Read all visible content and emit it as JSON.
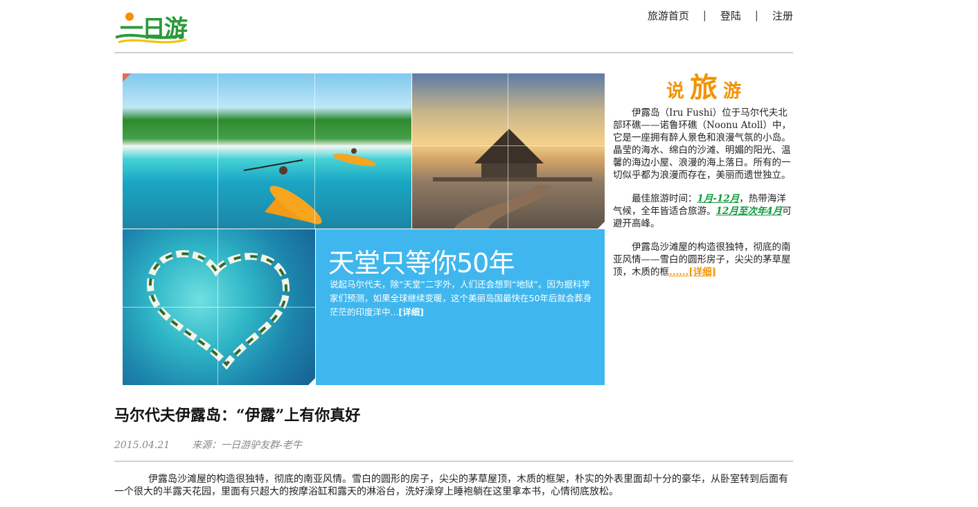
{
  "header": {
    "logo_text": "一日游",
    "nav": [
      {
        "label": "旅游首页"
      },
      {
        "label": "登陆"
      },
      {
        "label": "注册"
      }
    ],
    "nav_separator": "|"
  },
  "promo": {
    "title": "天堂只等你50年",
    "text": "说起马尔代夫，除“天堂”二字外，人们还会想到“地狱”。因为据科学家们预测，如果全球继续变暖，这个美丽岛国最快在50年后就会葬身茫茫的印度洋中...",
    "more_label": "[详细]"
  },
  "sidebar": {
    "heading_left": "说",
    "heading_mid": "旅",
    "heading_right": "游",
    "para1": "伊露岛（Iru Fushi）位于马尔代夫北部环礁——诺鲁环礁（Noonu Atoll）中，它是一座拥有醉人景色和浪漫气氛的小岛。晶莹的海水、绵白的沙滩、明媚的阳光、温馨的海边小屋、浪漫的海上落日。所有的一切似乎都为浪漫而存在，美丽而遗世独立。",
    "para2_prefix": "最佳旅游时间：",
    "para2_hl1": "1月-12月",
    "para2_mid": "，热带海洋气候，全年皆适合旅游。",
    "para2_hl2": "12月至次年4月",
    "para2_suffix": "可避开高峰。",
    "para3": "伊露岛沙滩屋的构造很独特，彻底的南亚风情——雪白的圆形房子，尖尖的茅草屋顶，木质的框",
    "para3_more": "......[详细]"
  },
  "article": {
    "title": "马尔代夫伊露岛：“伊露”上有你真好",
    "date": "2015.04.21",
    "source": "来源：一日游驴友群-老牛",
    "body": "伊露岛沙滩屋的构造很独特，彻底的南亚风情。雪白的圆形的房子，尖尖的茅草屋顶，木质的框架，朴实的外表里面却十分的豪华，从卧室转到后面有一个很大的半露天花园，里面有只超大的按摩浴缸和露天的淋浴台，洗好澡穿上睡袍躺在这里拿本书，心情彻底放松。"
  },
  "colors": {
    "accent_orange": "#f29300",
    "accent_green": "#139a3f",
    "promo_blue": "#3fb7ee",
    "logo_green": "#2a9a3a"
  }
}
